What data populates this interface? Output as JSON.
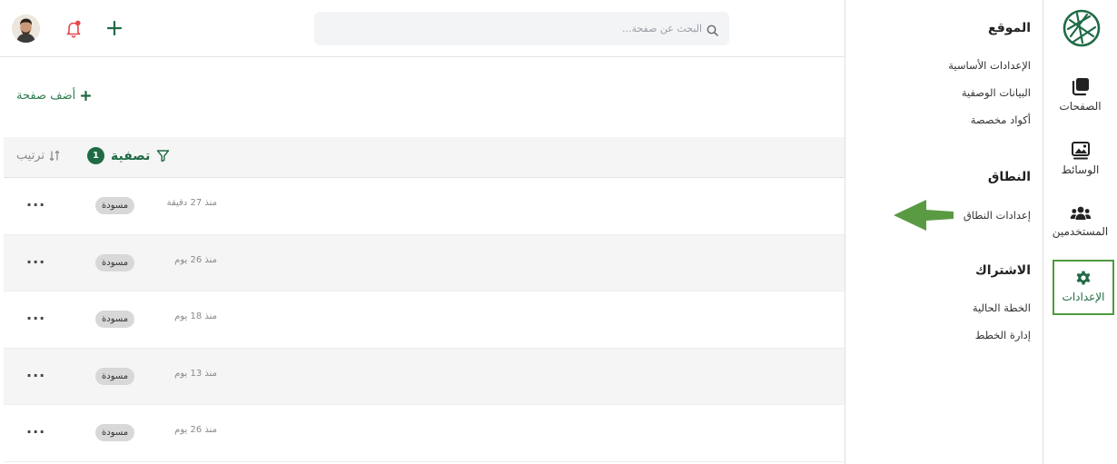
{
  "topbar": {
    "search_placeholder": "البحث عن صفحة..."
  },
  "main": {
    "add_page_label": "أضف صفحة",
    "filter_label": "تصفية",
    "filter_count": "1",
    "sort_label": "ترتيب",
    "rows": [
      {
        "time": "منذ 27 دقيقة",
        "status": "مسودة",
        "more": "···"
      },
      {
        "time": "منذ 26 يوم",
        "status": "مسودة",
        "more": "···"
      },
      {
        "time": "منذ 18 يوم",
        "status": "مسودة",
        "more": "···"
      },
      {
        "time": "منذ 13 يوم",
        "status": "مسودة",
        "more": "···"
      },
      {
        "time": "منذ 26 يوم",
        "status": "مسودة",
        "more": "···"
      }
    ]
  },
  "settings_panel": {
    "site": {
      "title": "الموقع",
      "links": [
        "الإعدادات الأساسية",
        "البيانات الوصفية",
        "أكواد مخصصة"
      ]
    },
    "domain": {
      "title": "النطاق",
      "links": [
        "إعدادات النطاق"
      ]
    },
    "subscription": {
      "title": "الاشتراك",
      "links": [
        "الخطة الحالية",
        "إدارة الخطط"
      ]
    }
  },
  "sidebar": {
    "items": [
      {
        "label": "الصفحات",
        "icon": "pages-icon"
      },
      {
        "label": "الوسائط",
        "icon": "media-icon"
      },
      {
        "label": "المستخدمين",
        "icon": "users-icon"
      },
      {
        "label": "الإعدادات",
        "icon": "settings-gear-icon",
        "active": true
      }
    ]
  },
  "colors": {
    "brand_green": "#1f6b45",
    "active_border": "#4f9a3e",
    "arrow_green": "#5a9a43",
    "notification_red": "#e5484d"
  }
}
